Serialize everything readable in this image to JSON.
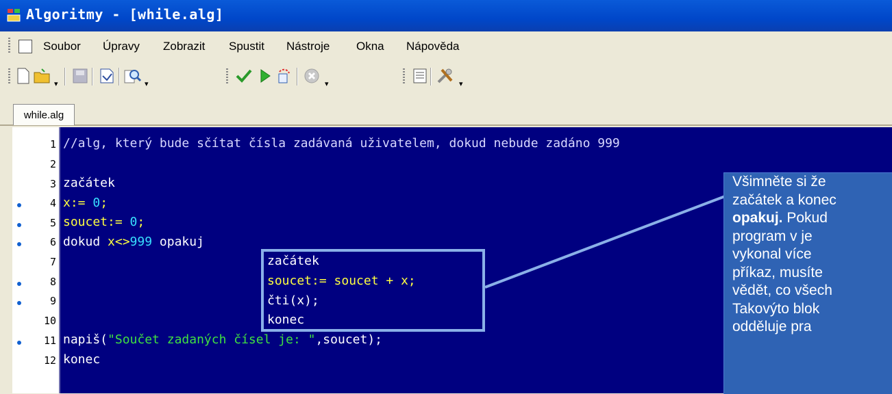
{
  "window": {
    "title": "Algoritmy - [while.alg]"
  },
  "menu": {
    "items": [
      "Soubor",
      "Úpravy",
      "Zobrazit",
      "Spustit",
      "Nástroje",
      "Okna",
      "Nápověda"
    ]
  },
  "toolbar": {
    "buttons": [
      "new-file-icon",
      "open-folder-icon",
      "save-icon",
      "save-as-icon",
      "find-icon",
      "check-icon",
      "run-icon",
      "step-icon",
      "stop-icon",
      "list-icon",
      "tools-icon"
    ]
  },
  "tabs": [
    {
      "label": "while.alg"
    }
  ],
  "editor": {
    "lines": [
      {
        "num": "1",
        "text": "//alg, který bude sčítat čísla zadávaná uživatelem, dokud nebude zadáno 999"
      },
      {
        "num": "2",
        "text": ""
      },
      {
        "num": "3",
        "text": "začátek"
      },
      {
        "num": "4",
        "text": "x:= 0;",
        "p1": "x:= ",
        "p2": "0",
        "p3": ";"
      },
      {
        "num": "5",
        "text": "soucet:= 0;",
        "p1": "soucet:= ",
        "p2": "0",
        "p3": ";"
      },
      {
        "num": "6",
        "text": "dokud x<>999 opakuj",
        "p1": "dokud ",
        "p2": "x<>",
        "p3": "999",
        "p4": " opakuj"
      },
      {
        "num": "7",
        "text": "začátek"
      },
      {
        "num": "8",
        "text": "soucet:= soucet + x;"
      },
      {
        "num": "9",
        "text": "čti(x);"
      },
      {
        "num": "10",
        "text": "konec"
      },
      {
        "num": "11",
        "text": "napiš(\"Součet zadaných čísel je: \",soucet);",
        "p1": "napiš(",
        "p2": "\"Součet zadaných čísel je: \"",
        "p3": ",soucet);"
      },
      {
        "num": "12",
        "text": "konec"
      }
    ]
  },
  "callout": {
    "lines": [
      "Všimněte  si  že",
      "začátek a konec",
      "opakuj. Pokud",
      "program    v je",
      "vykonal    více",
      "příkaz, musíte",
      "vědět, co všech",
      "Takovýto  blok",
      "odděluje      pra"
    ]
  },
  "colors": {
    "editor_bg": "#000080",
    "callout_bg": "#2f63b4",
    "titlebar": "#0047c9"
  }
}
